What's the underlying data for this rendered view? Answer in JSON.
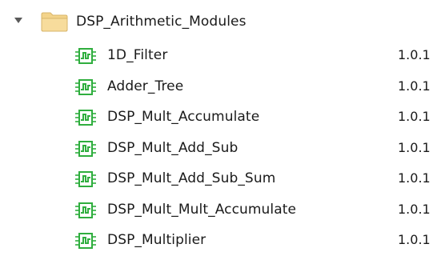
{
  "tree": {
    "folder": {
      "label": "DSP_Arithmetic_Modules",
      "expanded": true,
      "icon": "folder-icon",
      "icon_color": "#f2cf84"
    },
    "modules": [
      {
        "name": "1D_Filter",
        "version": "1.0.1",
        "icon": "module-waveform-icon"
      },
      {
        "name": "Adder_Tree",
        "version": "1.0.1",
        "icon": "module-waveform-icon"
      },
      {
        "name": "DSP_Mult_Accumulate",
        "version": "1.0.1",
        "icon": "module-waveform-icon"
      },
      {
        "name": "DSP_Mult_Add_Sub",
        "version": "1.0.1",
        "icon": "module-waveform-icon"
      },
      {
        "name": "DSP_Mult_Add_Sub_Sum",
        "version": "1.0.1",
        "icon": "module-waveform-icon"
      },
      {
        "name": "DSP_Mult_Mult_Accumulate",
        "version": "1.0.1",
        "icon": "module-waveform-icon"
      },
      {
        "name": "DSP_Multiplier",
        "version": "1.0.1",
        "icon": "module-waveform-icon"
      }
    ],
    "module_icon_color": "#2fae3e"
  }
}
